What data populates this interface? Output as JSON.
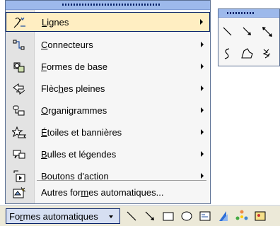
{
  "menu": {
    "items": [
      {
        "label_pre": "",
        "accel": "L",
        "label_post": "ignes",
        "icon": "lines-icon",
        "hover": true
      },
      {
        "label_pre": "",
        "accel": "C",
        "label_post": "onnecteurs",
        "icon": "connectors-icon",
        "hover": false
      },
      {
        "label_pre": "",
        "accel": "F",
        "label_post": "ormes de base",
        "icon": "basic-shapes-icon",
        "hover": false
      },
      {
        "label_pre": "Flèc",
        "accel": "h",
        "label_post": "es pleines",
        "icon": "block-arrows-icon",
        "hover": false
      },
      {
        "label_pre": "",
        "accel": "O",
        "label_post": "rganigrammes",
        "icon": "flowchart-icon",
        "hover": false
      },
      {
        "label_pre": "",
        "accel": "É",
        "label_post": "toiles et bannières",
        "icon": "stars-banners-icon",
        "hover": false
      },
      {
        "label_pre": "",
        "accel": "B",
        "label_post": "ulles et légendes",
        "icon": "callouts-icon",
        "hover": false
      },
      {
        "label_pre": "Bo",
        "accel": "u",
        "label_post": "tons d'action",
        "icon": "action-buttons-icon",
        "hover": false
      }
    ],
    "more": {
      "label_pre": "Autres for",
      "accel": "m",
      "label_post": "es automatiques...",
      "icon": "more-autoshapes-icon"
    }
  },
  "submenu": {
    "tools": [
      "line-icon",
      "arrow-icon",
      "double-arrow-icon",
      "curve-icon",
      "freeform-icon",
      "scribble-icon"
    ]
  },
  "toolbar": {
    "shapes_label_pre": "Fo",
    "shapes_label_accel": "r",
    "shapes_label_post": "mes automatiques",
    "tools": [
      "line-tool-icon",
      "arrow-tool-icon",
      "rectangle-tool-icon",
      "oval-tool-icon",
      "textbox-tool-icon",
      "wordart-tool-icon",
      "diagram-tool-icon",
      "clipart-tool-icon"
    ]
  },
  "colors": {
    "hover_bg": "#ffeec2",
    "hover_border": "#0a246a",
    "menu_bg": "#f6f6f6",
    "icon_strip": "#e3e3e3",
    "toolbar_bg": "#ece9d8",
    "grip": "#9db9eb"
  }
}
